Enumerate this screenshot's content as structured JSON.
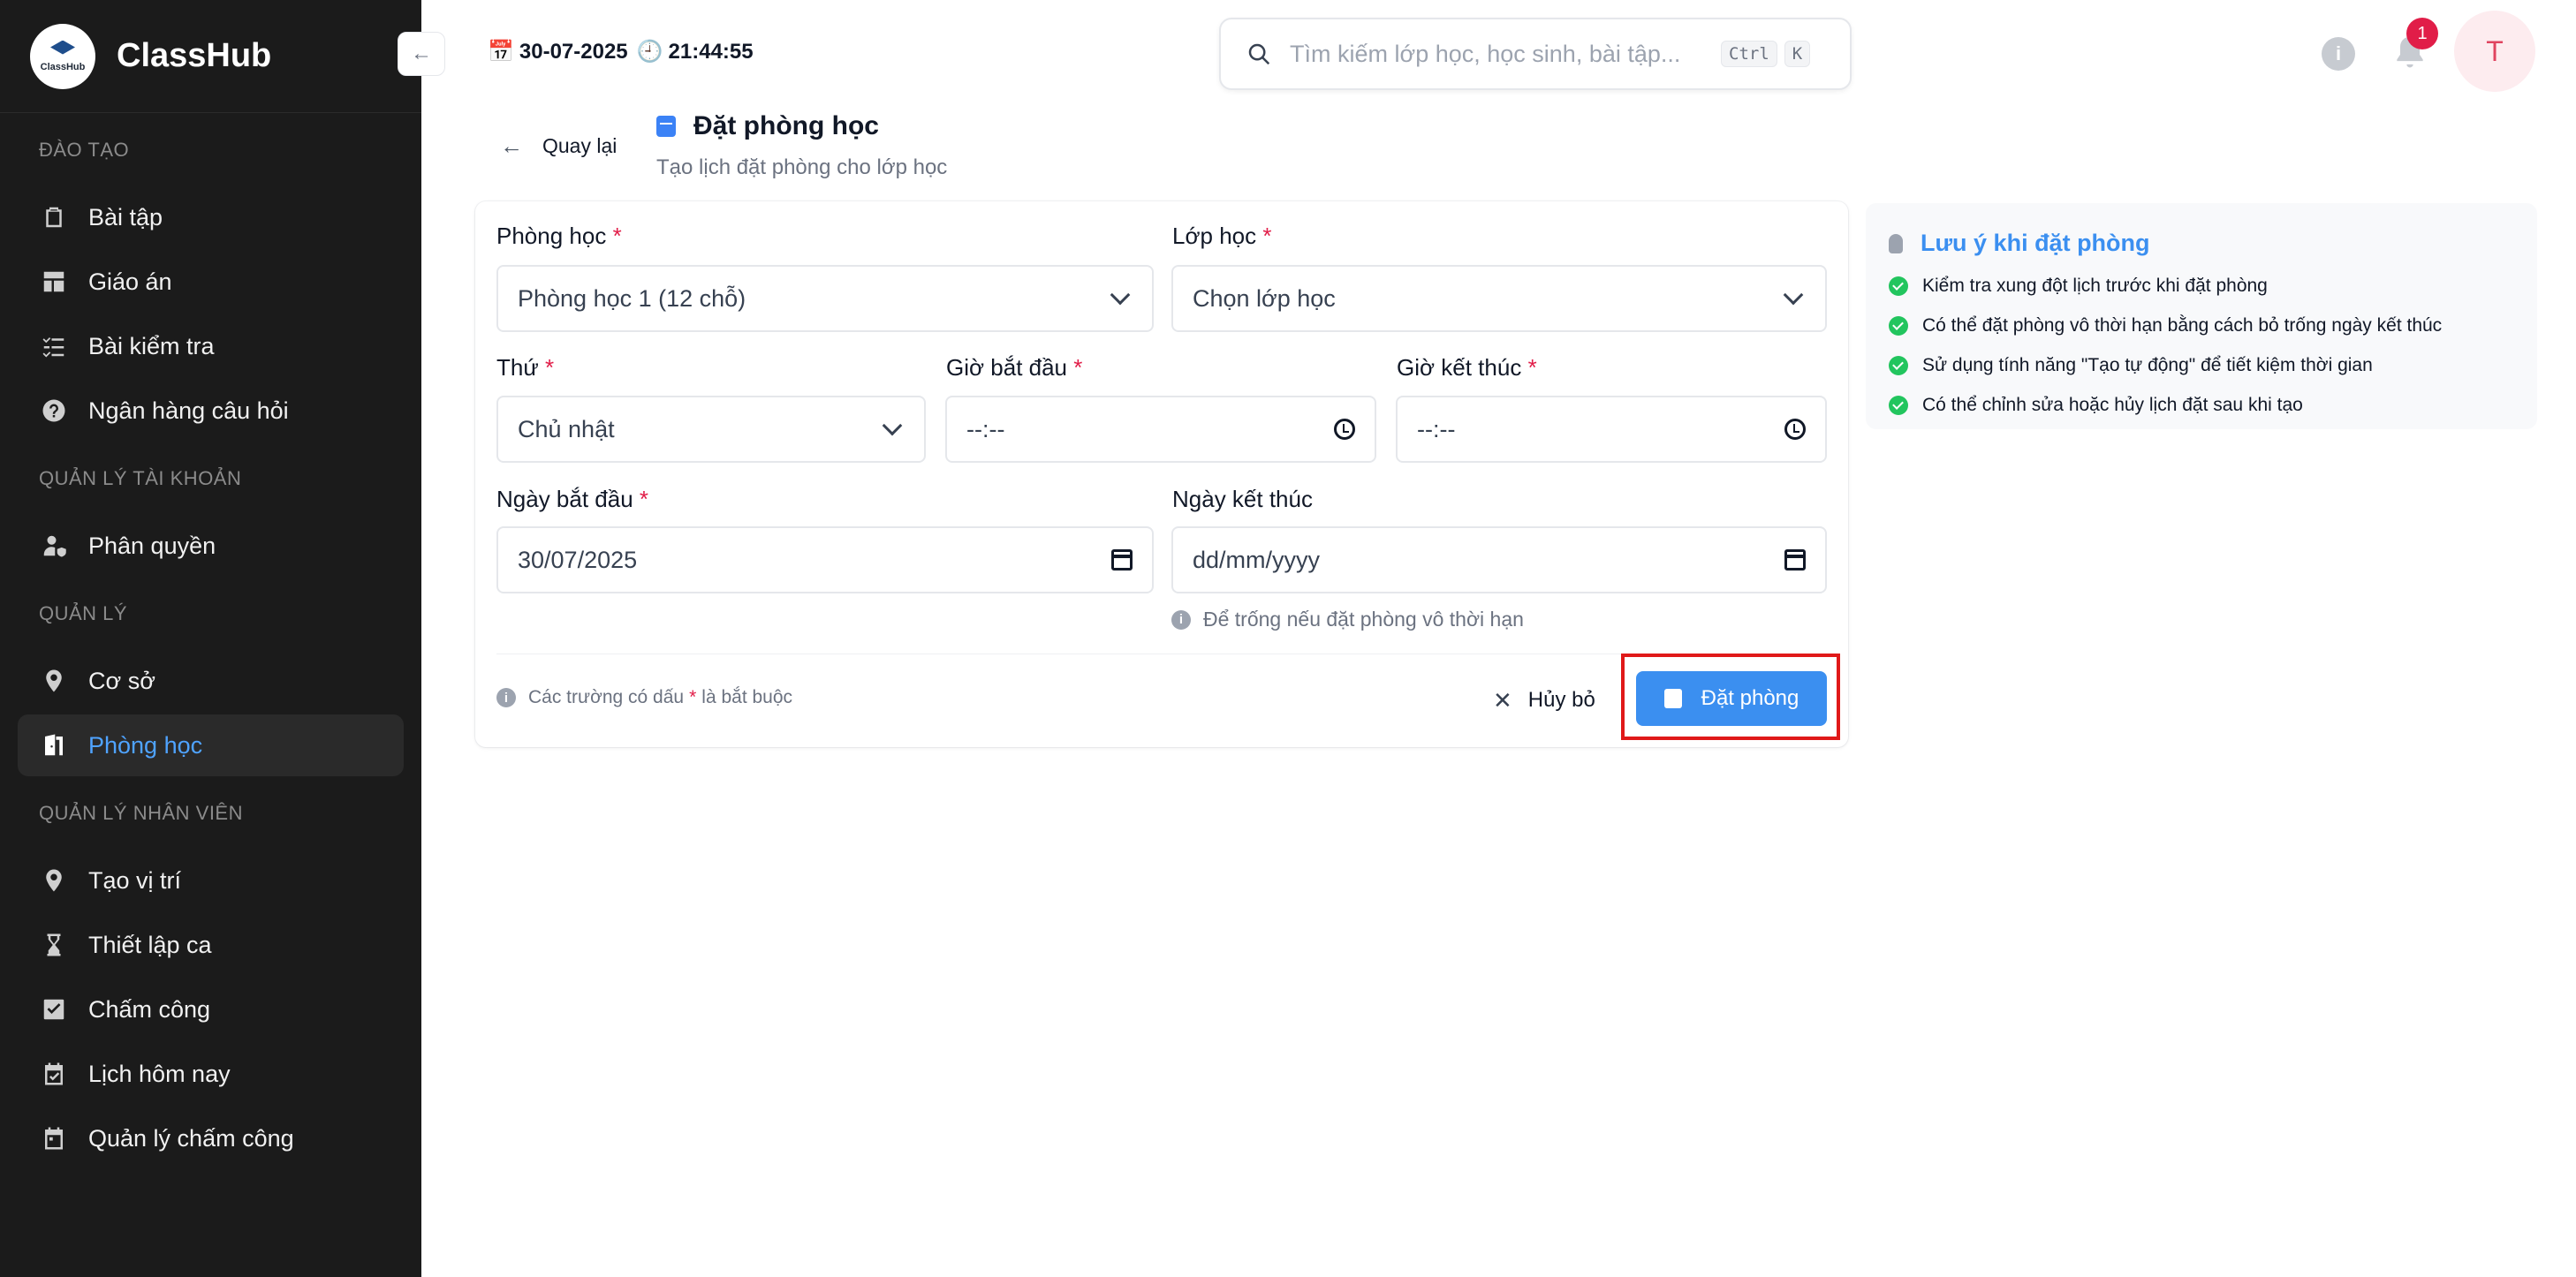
{
  "app": {
    "name": "ClassHub",
    "logo_text": "ClassHub"
  },
  "sidebar": {
    "collapse_icon": "←",
    "sections": [
      {
        "title": "ĐÀO TẠO",
        "items": [
          {
            "label": "Bài tập",
            "icon": "clipboard-icon"
          },
          {
            "label": "Giáo án",
            "icon": "layout-icon"
          },
          {
            "label": "Bài kiểm tra",
            "icon": "checklist-icon"
          },
          {
            "label": "Ngân hàng câu hỏi",
            "icon": "question-icon"
          }
        ]
      },
      {
        "title": "QUẢN LÝ TÀI KHOẢN",
        "items": [
          {
            "label": "Phân quyền",
            "icon": "user-shield-icon"
          }
        ]
      },
      {
        "title": "QUẢN LÝ",
        "items": [
          {
            "label": "Cơ sở",
            "icon": "location-pin-icon"
          },
          {
            "label": "Phòng học",
            "icon": "door-icon",
            "active": true
          }
        ]
      },
      {
        "title": "QUẢN LÝ NHÂN VIÊN",
        "items": [
          {
            "label": "Tạo vị trí",
            "icon": "location-pin-icon"
          },
          {
            "label": "Thiết lập ca",
            "icon": "hourglass-icon"
          },
          {
            "label": "Chấm công",
            "icon": "checkbox-icon"
          },
          {
            "label": "Lịch hôm nay",
            "icon": "calendar-check-icon"
          },
          {
            "label": "Quản lý chấm công",
            "icon": "calendar-icon"
          }
        ]
      }
    ]
  },
  "header": {
    "date": "30-07-2025",
    "time": "21:44:55",
    "search_placeholder": "Tìm kiếm lớp học, học sinh, bài tập...",
    "shortcut_ctrl": "Ctrl",
    "shortcut_key": "K",
    "notification_count": "1",
    "avatar_initial": "T",
    "info_glyph": "i"
  },
  "page": {
    "back_label": "Quay lại",
    "title": "Đặt phòng học",
    "subtitle": "Tạo lịch đặt phòng cho lớp học"
  },
  "form": {
    "room_label": "Phòng học",
    "room_value": "Phòng học 1 (12 chỗ)",
    "class_label": "Lớp học",
    "class_value": "Chọn lớp học",
    "day_label": "Thứ",
    "day_value": "Chủ nhật",
    "start_time_label": "Giờ bắt đầu",
    "start_time_value": "--:--",
    "end_time_label": "Giờ kết thúc",
    "end_time_value": "--:--",
    "start_date_label": "Ngày bắt đầu",
    "start_date_value": "30/07/2025",
    "end_date_label": "Ngày kết thúc",
    "end_date_value": "dd/mm/yyyy",
    "end_date_hint": "Để trống nếu đặt phòng vô thời hạn",
    "required_mark": "*",
    "footer_note_before": "Các trường có dấu",
    "footer_note_after": "là bắt buộc",
    "cancel_label": "Hủy bỏ",
    "submit_label": "Đặt phòng"
  },
  "notes": {
    "title": "Lưu ý khi đặt phòng",
    "items": [
      "Kiểm tra xung đột lịch trước khi đặt phòng",
      "Có thể đặt phòng vô thời hạn bằng cách bỏ trống ngày kết thúc",
      "Sử dụng tính năng \"Tạo tự động\" để tiết kiệm thời gian",
      "Có thể chỉnh sửa hoặc hủy lịch đặt sau khi tạo"
    ]
  },
  "colors": {
    "accent": "#3b8ff0",
    "required": "#e11d48",
    "highlight": "#e01919",
    "sidebar_bg": "#1b1b1b",
    "check": "#22c55e"
  }
}
